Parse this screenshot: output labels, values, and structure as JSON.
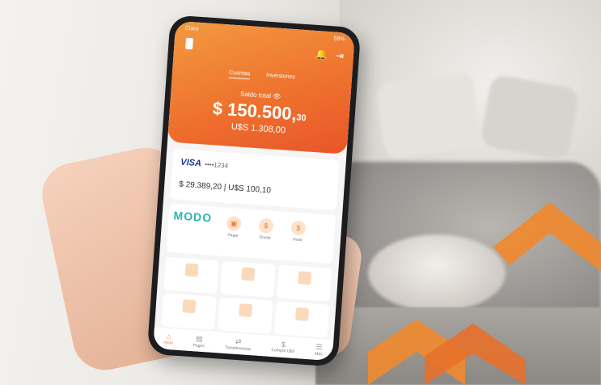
{
  "status_bar": {
    "carrier": "Claro",
    "battery": "59%"
  },
  "tabs": [
    {
      "label": "Cuentas"
    },
    {
      "label": "Inversiones"
    }
  ],
  "balance": {
    "label": "Saldo total",
    "ars_main": "$ 150.500,",
    "ars_cents": "30",
    "usd": "U$S 1.308,00"
  },
  "card": {
    "brand": "VISA",
    "number": "••••1234",
    "amount": "$ 29.389,20  |  U$S 100,10"
  },
  "modo": {
    "logo": "MODO",
    "quick_actions": [
      {
        "label": "Pagar"
      },
      {
        "label": "Enviar"
      },
      {
        "label": "Pedir"
      }
    ]
  },
  "nav": [
    {
      "label": "Inicio"
    },
    {
      "label": "Pagos"
    },
    {
      "label": "Transferencias"
    },
    {
      "label": "Compra U$S"
    },
    {
      "label": "Más"
    }
  ],
  "colors": {
    "brand_orange": "#ee6f2d",
    "accent_teal": "#2bb3b1",
    "visa_blue": "#1a3c8e"
  }
}
